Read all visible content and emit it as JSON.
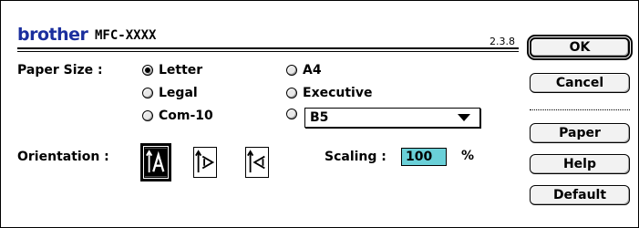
{
  "header": {
    "brand": "brother",
    "model": "MFC-XXXX",
    "version": "2.3.8"
  },
  "paper_size": {
    "label": "Paper Size :",
    "options": [
      {
        "label": "Letter",
        "selected": true
      },
      {
        "label": "Legal",
        "selected": false
      },
      {
        "label": "Com-10",
        "selected": false
      },
      {
        "label": "A4",
        "selected": false
      },
      {
        "label": "Executive",
        "selected": false
      },
      {
        "label": "",
        "selected": false
      }
    ],
    "custom_select_value": "B5"
  },
  "orientation": {
    "label": "Orientation :",
    "options": [
      "portrait",
      "landscape-right",
      "landscape-left"
    ],
    "selected": "portrait"
  },
  "scaling": {
    "label": "Scaling :",
    "value": "100",
    "unit": "%"
  },
  "buttons": {
    "ok": "OK",
    "cancel": "Cancel",
    "paper": "Paper",
    "help": "Help",
    "default": "Default"
  },
  "colors": {
    "brand": "#1b2f9e",
    "scaling_field": "#6ad0d8"
  }
}
